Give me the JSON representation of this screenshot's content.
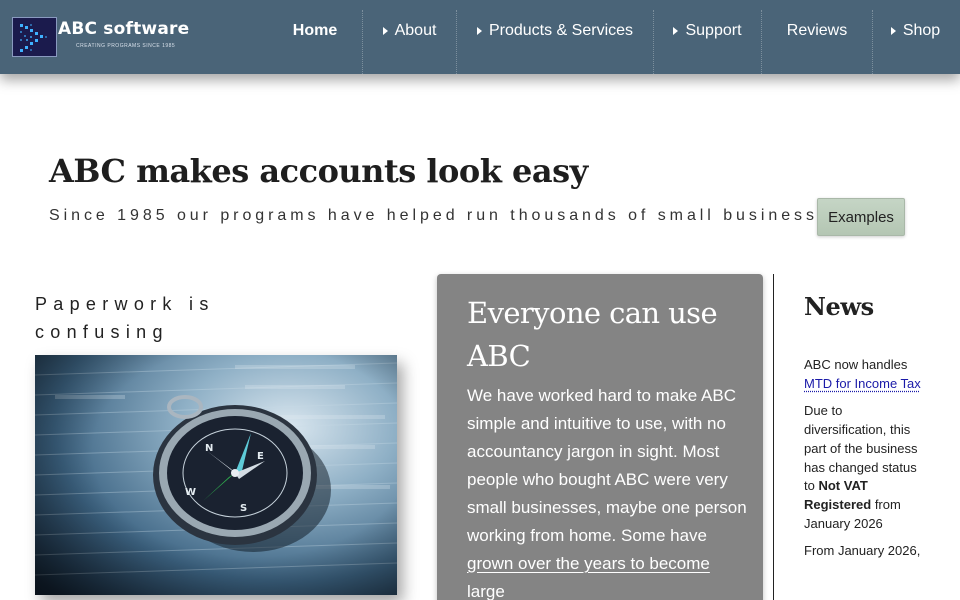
{
  "logo": {
    "name": "ABC software",
    "tagline": "CREATING PROGRAMS SINCE 1985"
  },
  "nav": {
    "items": [
      {
        "label": "Home",
        "active": true,
        "submenu": false
      },
      {
        "label": "About",
        "active": false,
        "submenu": true
      },
      {
        "label": "Products & Services",
        "active": false,
        "submenu": true
      },
      {
        "label": "Support",
        "active": false,
        "submenu": true
      },
      {
        "label": "Reviews",
        "active": false,
        "submenu": false
      },
      {
        "label": "Shop",
        "active": false,
        "submenu": true
      }
    ]
  },
  "hero": {
    "title": "ABC makes accounts look easy",
    "subtitle": "Since 1985 our programs have helped run thousands of small businesses",
    "button_label": "Examples"
  },
  "left": {
    "heading": "Paperwork is confusing",
    "image": "compass-on-financial-papers"
  },
  "card": {
    "title": "Everyone can use ABC",
    "body_before_link": "We have worked hard to make ABC simple and intuitive to use, with no accountancy jargon in sight. Most people who bought ABC were very small businesses, maybe one person working from home. Some have ",
    "link_text": "grown over the years to become large",
    "background": "#848484"
  },
  "news": {
    "title": "News",
    "item1_text": "ABC now handles ",
    "item1_link": "MTD for Income Tax",
    "item2_before": "Due to diversification, this part of the business has changed status to ",
    "item2_strong": "Not VAT Registered",
    "item2_after": " from January 2026",
    "item3": "From January 2026,"
  },
  "colors": {
    "header": "#4a6478",
    "button": "#b9cab8",
    "card": "#848484",
    "link": "#1a1aa8"
  }
}
